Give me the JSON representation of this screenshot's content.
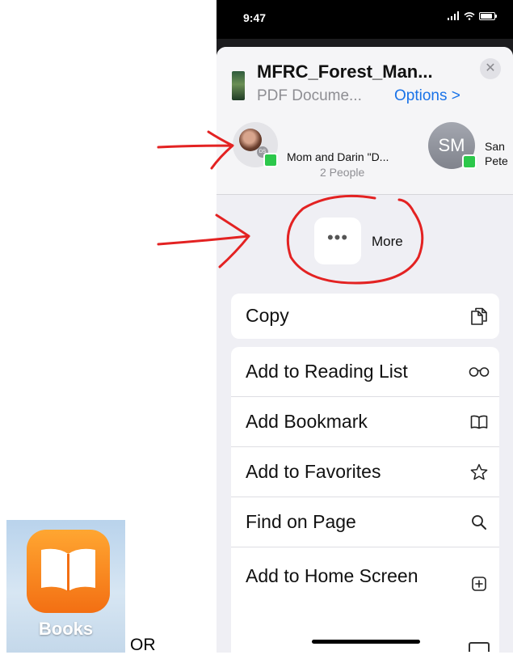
{
  "status_bar": {
    "time": "9:47"
  },
  "share_sheet": {
    "header": {
      "title": "MFRC_Forest_Man...",
      "subtitle": "PDF Docume...",
      "options_label": "Options >",
      "close_glyph": "✕"
    },
    "contacts": [
      {
        "name": "Mom and Darin \"D...",
        "detail": "2 People",
        "avatar_initials": "DS"
      },
      {
        "name": "San",
        "detail": "Pete",
        "avatar_initials": "SM"
      }
    ],
    "more_action": {
      "glyph": "•••",
      "label": "More"
    },
    "copy_action": {
      "label": "Copy",
      "icon": "copy-icon"
    },
    "actions": [
      {
        "label": "Add to Reading List",
        "icon": "glasses-icon"
      },
      {
        "label": "Add Bookmark",
        "icon": "book-icon"
      },
      {
        "label": "Add to Favorites",
        "icon": "star-icon"
      },
      {
        "label": "Find on Page",
        "icon": "search-icon"
      },
      {
        "label": "Add to Home Screen",
        "icon": "plus-square-icon"
      }
    ],
    "peek_action": {
      "icon": "folder-icon"
    }
  },
  "books_app": {
    "label": "Books"
  },
  "or_text": "OR",
  "colors": {
    "annotation_red": "#e32222",
    "link_blue": "#1a73e8",
    "message_green": "#2cc84b",
    "books_orange": "#f6871f"
  }
}
